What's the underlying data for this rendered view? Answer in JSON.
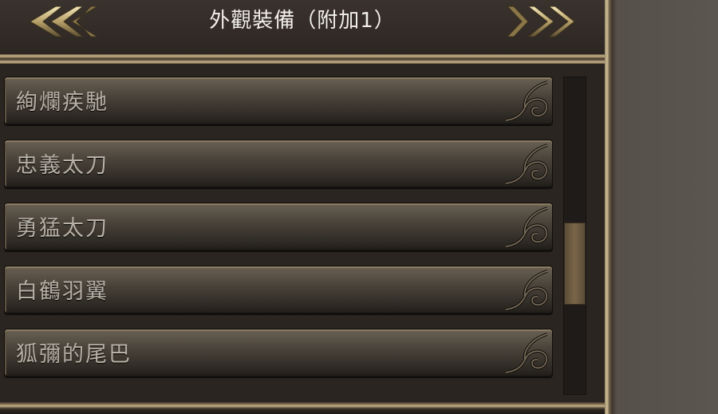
{
  "header": {
    "title": "外觀裝備（附加1）",
    "prev_icon": "double-chevron-left-icon",
    "next_icon": "double-chevron-right-icon"
  },
  "items": [
    {
      "label": "絢爛疾馳"
    },
    {
      "label": "忠義太刀"
    },
    {
      "label": "勇猛太刀"
    },
    {
      "label": "白鶴羽翼"
    },
    {
      "label": "狐彌的尾巴"
    }
  ],
  "scrollbar": {
    "position_fraction": 0.62,
    "thumb_fraction": 0.26
  },
  "colors": {
    "gold": "#c7b48c",
    "label": "#b7b0a5",
    "title": "#f2efe9"
  }
}
